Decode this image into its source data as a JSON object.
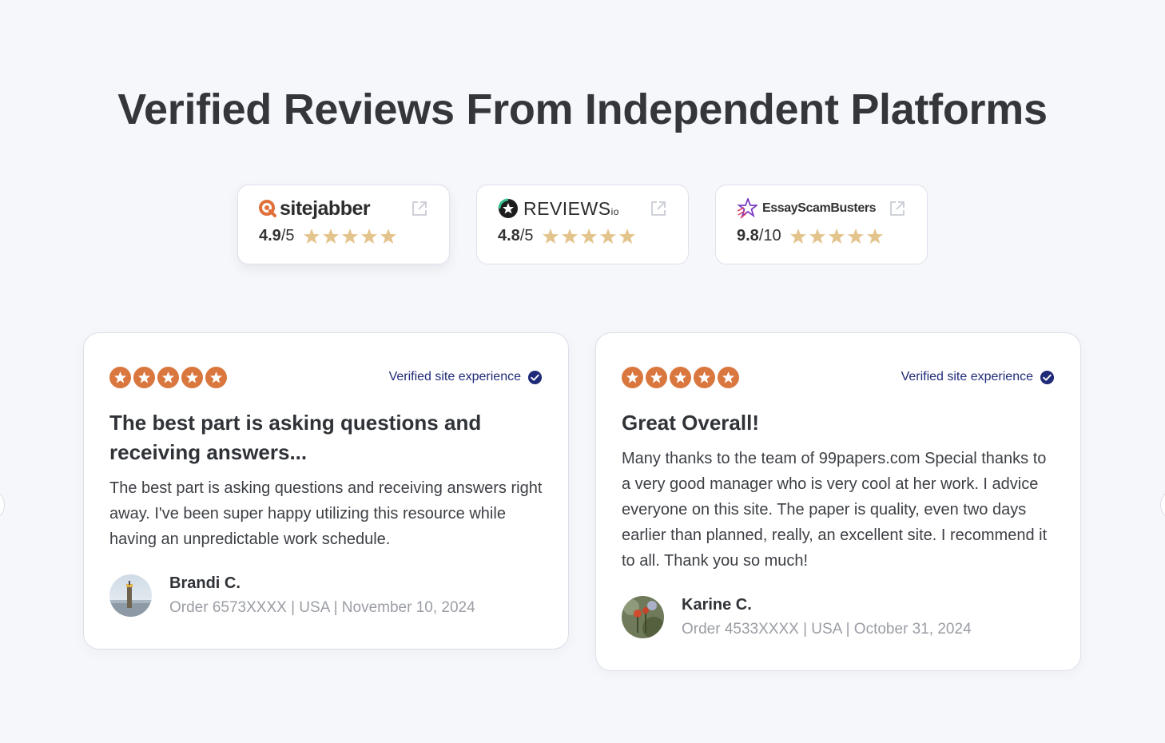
{
  "heading": "Verified Reviews From Independent Platforms",
  "platforms": [
    {
      "name": "sitejabber",
      "score": "4.9",
      "max": "/5",
      "stars": 5,
      "icon": "external-link-icon"
    },
    {
      "name": "REVIEWS",
      "suffix": "io",
      "score": "4.8",
      "max": "/5",
      "stars": 5,
      "icon": "external-link-icon"
    },
    {
      "name": "EssayScamBusters",
      "score": "9.8",
      "max": "/10",
      "stars": 5,
      "icon": "external-link-icon"
    }
  ],
  "reviews": [
    {
      "stars": 5,
      "verified_label": "Verified site experience",
      "title": "The best part is asking questions and receiving answers...",
      "body": "The best part is asking questions and receiving answers right away. I've been super happy utilizing this resource while having an unpredictable work schedule.",
      "author": "Brandi C.",
      "meta": "Order 6573XXXX | USA | November 10, 2024"
    },
    {
      "stars": 5,
      "verified_label": "Verified site experience",
      "title": "Great Overall!",
      "body": "Many thanks to the team of 99papers.com Special thanks to a very good manager who is very cool at her work. I advice everyone on this site. The paper is quality, even two days earlier than planned, really, an excellent site. I recommend it to all. Thank you so much!",
      "author": "Karine C.",
      "meta": "Order 4533XXXX | USA | October 31, 2024"
    }
  ],
  "colors": {
    "platform_star": "#e4c48d",
    "review_star_bg": "#d9773f",
    "verified": "#1f2a78"
  }
}
